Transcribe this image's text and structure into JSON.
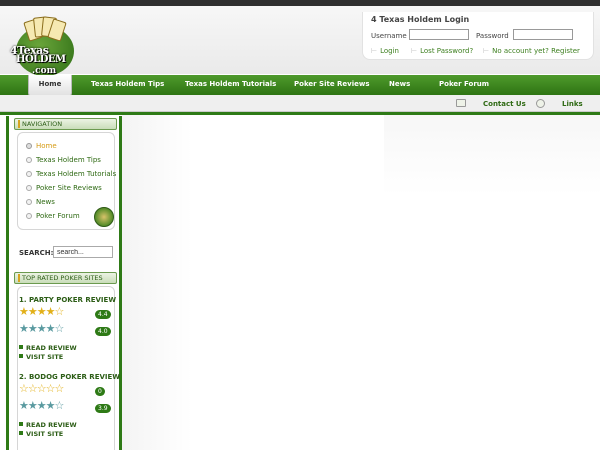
{
  "header": {
    "logo_text_line1": "4Texas",
    "logo_text_line2": "HOLDEM",
    "logo_text_line3": ".com"
  },
  "login": {
    "title": "4 Texas Holdem Login",
    "username_label": "Username",
    "password_label": "Password",
    "username_value": "",
    "password_value": "",
    "links": [
      "Login",
      "Lost Password?",
      "No account yet? Register"
    ]
  },
  "nav": {
    "items": [
      "Home",
      "Texas Holdem Tips",
      "Texas Holdem Tutorials",
      "Poker Site Reviews",
      "News",
      "Poker Forum"
    ],
    "active": "Home"
  },
  "subnav": {
    "contact": "Contact Us",
    "links": "Links"
  },
  "sidebar": {
    "navigation_title": "NAVIGATION",
    "nav_links": [
      "Home",
      "Texas Holdem Tips",
      "Texas Holdem Tutorials",
      "Poker Site Reviews",
      "News",
      "Poker Forum"
    ],
    "search_label": "SEARCH:",
    "search_placeholder": "search...",
    "top_rated_title": "TOP RATED POKER SITES",
    "sites": [
      {
        "name": "1. PARTY POKER REVIEW",
        "rating1": "4.4",
        "rating1_stars": "★★★★☆",
        "rating2": "4.0",
        "rating2_stars": "★★★★☆",
        "read": "READ REVIEW",
        "visit": "VISIT SITE"
      },
      {
        "name": "2. BODOG POKER REVIEW",
        "rating1": "0",
        "rating1_stars": "☆☆☆☆☆",
        "rating2": "3.9",
        "rating2_stars": "★★★★☆",
        "read": "READ REVIEW",
        "visit": "VISIT SITE"
      }
    ]
  },
  "colors": {
    "brand_green": "#2e7a16",
    "nav_green": "#4f9a2c",
    "link_green": "#2f6a14",
    "active_orange": "#d59b14",
    "star_gold": "#e2b019",
    "star_teal": "#5a9aa0"
  }
}
